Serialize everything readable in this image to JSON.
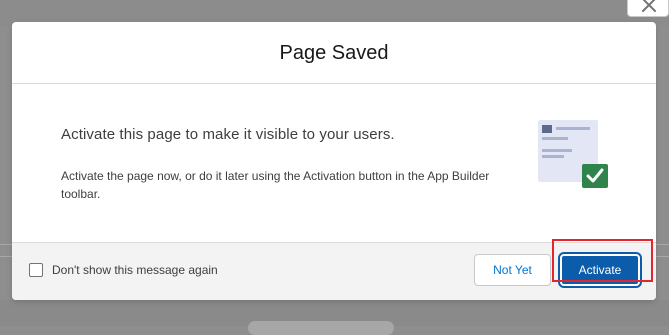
{
  "modal": {
    "title": "Page Saved",
    "heading": "Activate this page to make it visible to your users.",
    "text": "Activate the page now, or do it later using the Activation button in the App Builder toolbar.",
    "illustration_icon": "page-activated-illustration"
  },
  "footer": {
    "checkbox_label": "Don't show this message again",
    "checkbox_checked": false,
    "not_yet_label": "Not Yet",
    "activate_label": "Activate"
  },
  "colors": {
    "brand_blue": "#0b5cab",
    "link_blue": "#0176d3",
    "success_green": "#2e844a",
    "highlight_red": "#e0272f"
  }
}
